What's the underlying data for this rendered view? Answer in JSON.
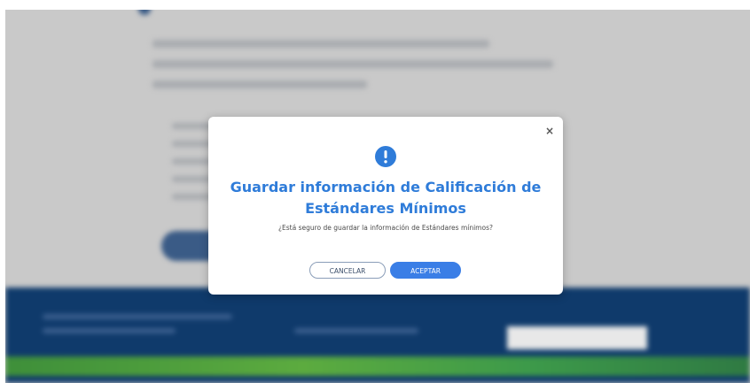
{
  "modal": {
    "close_label": "×",
    "title": "Guardar información de Calificación de Estándares Mínimos",
    "message": "¿Está seguro de guardar la información de Estándares mínimos?",
    "cancel_label": "CANCELAR",
    "accept_label": "ACEPTAR",
    "icon": "alert-circle-icon"
  },
  "colors": {
    "title": "#2f7cd9",
    "primary_button": "#3a7ee6",
    "footer": "#0f3a6b",
    "footer_stripe": "#5cab3f",
    "overlay": "#c9c9c9"
  }
}
